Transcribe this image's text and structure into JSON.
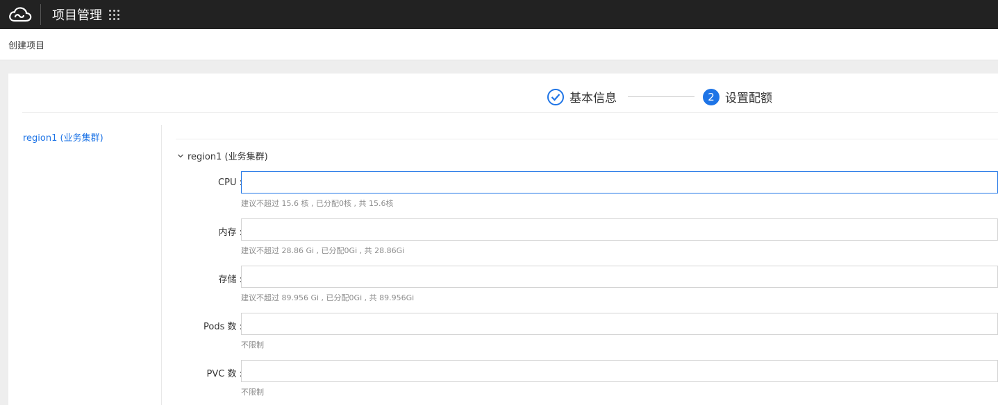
{
  "header": {
    "title": "项目管理"
  },
  "breadcrumb": {
    "current": "创建项目"
  },
  "steps": [
    {
      "number": "1",
      "label": "基本信息",
      "status": "done"
    },
    {
      "number": "2",
      "label": "设置配额",
      "status": "active"
    }
  ],
  "sidebar": {
    "items": [
      {
        "label": "region1 (业务集群)"
      }
    ]
  },
  "section": {
    "title": "region1 (业务集群)"
  },
  "fields": [
    {
      "label": "CPU :",
      "value": "",
      "hint": "建议不超过 15.6 核 , 已分配0核 , 共 15.6核"
    },
    {
      "label": "内存 :",
      "value": "",
      "hint": "建议不超过 28.86 Gi , 已分配0Gi , 共 28.86Gi"
    },
    {
      "label": "存储 :",
      "value": "",
      "hint": "建议不超过 89.956 Gi , 已分配0Gi , 共 89.956Gi"
    },
    {
      "label": "Pods 数 :",
      "value": "",
      "hint": "不限制"
    },
    {
      "label": "PVC 数 :",
      "value": "",
      "hint": "不限制"
    }
  ],
  "colors": {
    "accent": "#1e74e6",
    "topbar": "#222222"
  },
  "icons": {
    "logo": "cloud-logo-icon",
    "apps": "apps-grid-icon",
    "step_done": "check-icon",
    "collapse": "chevron-down-icon"
  }
}
